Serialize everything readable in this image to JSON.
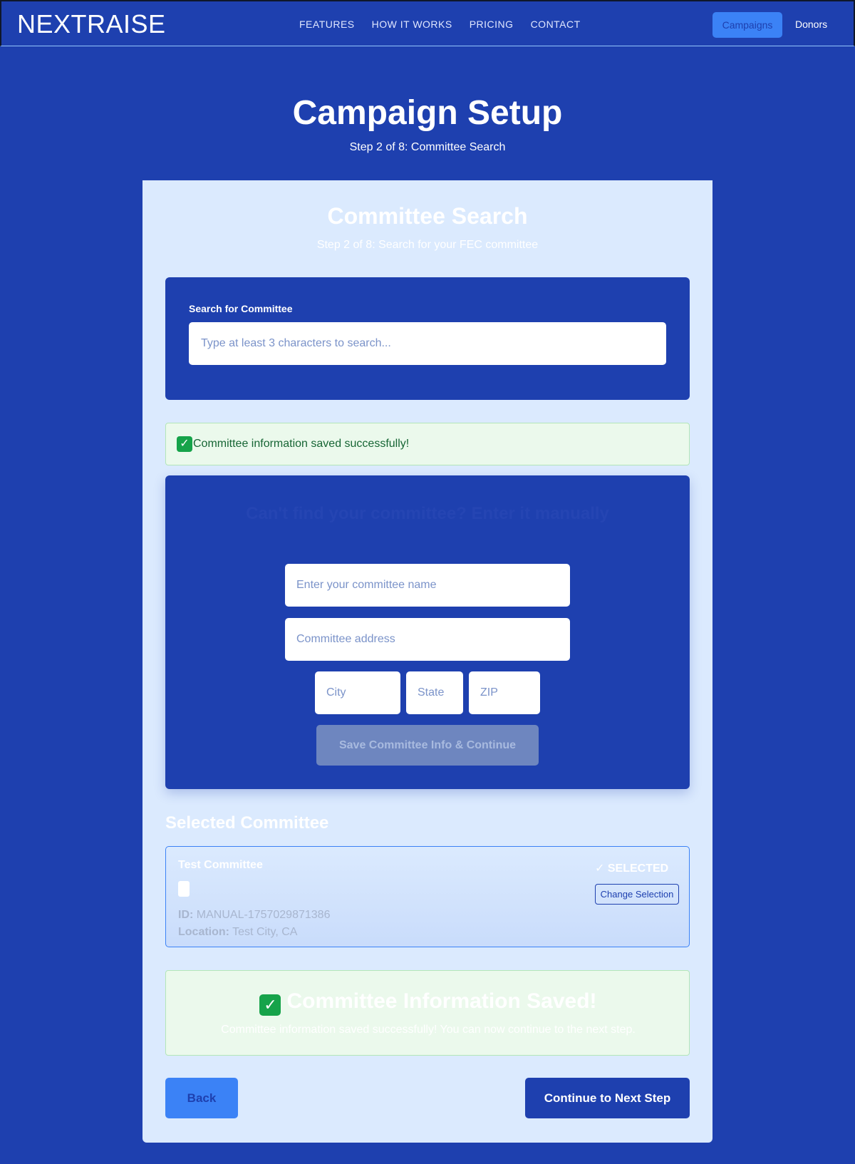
{
  "nav": {
    "logo": "NEXTRAISE",
    "links": [
      "FEATURES",
      "HOW IT WORKS",
      "PRICING",
      "CONTACT"
    ],
    "campaigns": "Campaigns",
    "donors": "Donors"
  },
  "header": {
    "title": "Campaign Setup",
    "subtitle": "Step 2 of 8: Committee Search"
  },
  "card": {
    "title": "Committee Search",
    "subtitle": "Step 2 of 8: Search for your FEC committee"
  },
  "search": {
    "label": "Search for Committee",
    "placeholder": "Type at least 3 characters to search...",
    "value": ""
  },
  "banner": {
    "message": "Committee information saved successfully!"
  },
  "manual": {
    "title": "Can't find your committee? Enter it manually",
    "name_placeholder": "Enter your committee name",
    "address_placeholder": "Committee address",
    "city_placeholder": "City",
    "state_placeholder": "State",
    "zip_placeholder": "ZIP",
    "save_label": "Save Committee Info & Continue"
  },
  "selected": {
    "heading": "Selected Committee",
    "name": "Test Committee",
    "id_label": "ID:",
    "id_value": "MANUAL-1757029871386",
    "location_label": "Location:",
    "location_value": "Test City, CA",
    "status": "✓ SELECTED",
    "change_label": "Change Selection"
  },
  "saved": {
    "title": "Committee Information Saved!",
    "subtitle": "Committee information saved successfully! You can now continue to the next step."
  },
  "footer": {
    "back_label": "Back",
    "next_label": "Continue to Next Step"
  }
}
